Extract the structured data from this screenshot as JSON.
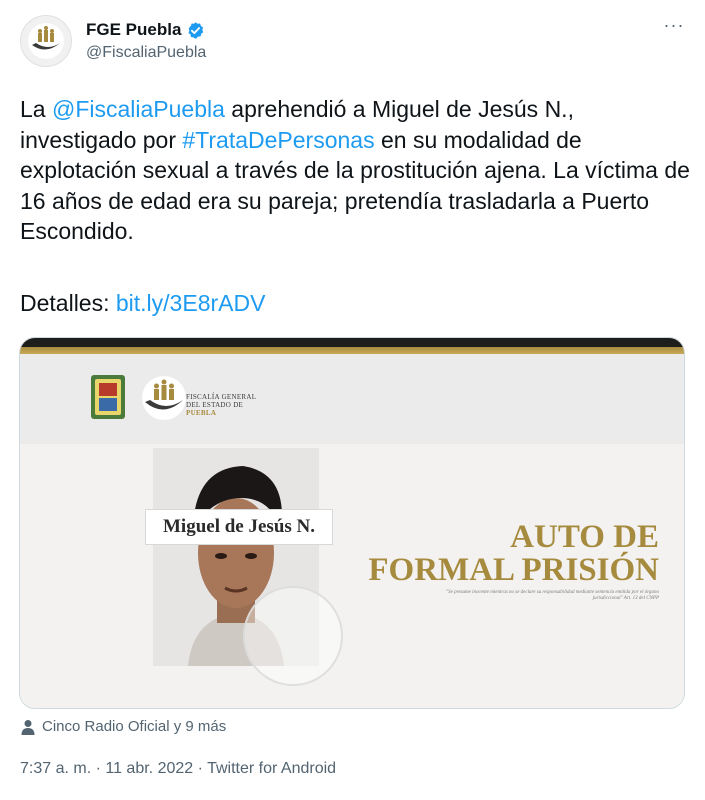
{
  "author": {
    "display_name": "FGE Puebla",
    "handle": "@FiscaliaPuebla"
  },
  "tweet": {
    "text_prefix": "La ",
    "mention": "@FiscaliaPuebla",
    "text_mid1": " aprehendió a Miguel de Jesús N., investigado por ",
    "hashtag": "#TrataDePersonas",
    "text_mid2": " en su modalidad de explotación sexual a través de la prostitución ajena. La víctima de 16 años de edad era su pareja; pretendía trasladarla a Puerto Escondido.",
    "details_label": "Detalles: ",
    "link": "bit.ly/3E8rADV"
  },
  "media": {
    "agency_line1": "FISCALÍA GENERAL",
    "agency_line2": "DEL ESTADO DE",
    "agency_line3": "PUEBLA",
    "name_tag": "Miguel de Jesús N.",
    "title_line1": "AUTO DE",
    "title_line2": "FORMAL PRISIÓN",
    "subtitle": "\"Se presume inocente mientras no se declare su responsabilidad mediante sentencia emitida por el órgano jurisdiccional\" Art. 13 del CNPP"
  },
  "tagged": "Cinco Radio Oficial y 9 más",
  "meta": {
    "time": "7:37 a. m.",
    "sep1": " · ",
    "date": "11 abr. 2022",
    "sep2": " · ",
    "source": "Twitter for Android"
  },
  "colors": {
    "link": "#1d9bf0",
    "verified": "#1d9bf0",
    "gold": "#a68a3e",
    "muted": "#536471"
  },
  "icons": [
    "fge-logo-icon",
    "verified-badge-icon",
    "more-icon",
    "puebla-shield-icon",
    "person-icon"
  ]
}
